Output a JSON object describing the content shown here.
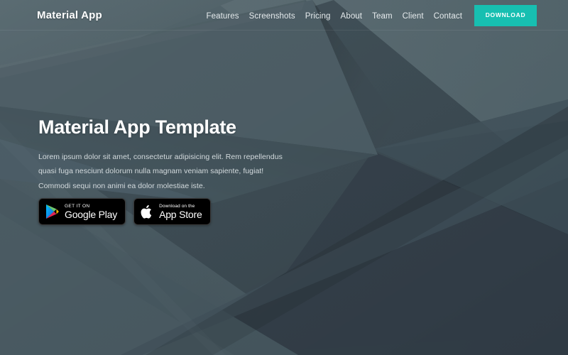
{
  "brand": {
    "name": "Material App"
  },
  "nav": {
    "items": [
      {
        "label": "Features",
        "name": "nav-item-features"
      },
      {
        "label": "Screenshots",
        "name": "nav-item-screenshots"
      },
      {
        "label": "Pricing",
        "name": "nav-item-pricing"
      },
      {
        "label": "About",
        "name": "nav-item-about"
      },
      {
        "label": "Team",
        "name": "nav-item-team"
      },
      {
        "label": "Client",
        "name": "nav-item-client"
      },
      {
        "label": "Contact",
        "name": "nav-item-contact"
      }
    ],
    "download_label": "DOWNLOAD",
    "accent_color": "#17bfb1"
  },
  "hero": {
    "title": "Material App Template",
    "paragraph": "Lorem ipsum dolor sit amet, consectetur adipisicing elit. Rem repellendus quasi fuga nesciunt dolorum nulla magnam veniam sapiente, fugiat! Commodi sequi non animi ea dolor molestiae iste.",
    "background_color": "#4a5c63"
  },
  "badges": {
    "google_play": {
      "small": "GET IT ON",
      "big": "Google Play"
    },
    "app_store": {
      "small": "Download on the",
      "big": "App Store"
    }
  }
}
